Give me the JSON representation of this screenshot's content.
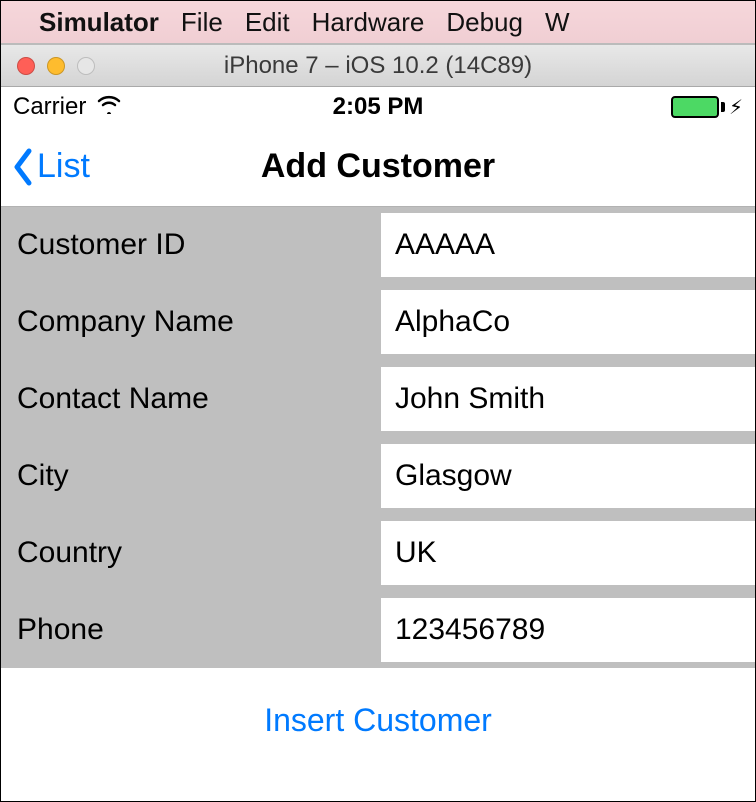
{
  "macMenu": {
    "appName": "Simulator",
    "items": [
      "File",
      "Edit",
      "Hardware",
      "Debug",
      "W"
    ]
  },
  "windowTitle": "iPhone 7 – iOS 10.2 (14C89)",
  "statusBar": {
    "carrier": "Carrier",
    "time": "2:05 PM"
  },
  "navBar": {
    "backLabel": "List",
    "title": "Add Customer"
  },
  "form": {
    "fields": [
      {
        "label": "Customer ID",
        "value": "AAAAA"
      },
      {
        "label": "Company Name",
        "value": "AlphaCo"
      },
      {
        "label": "Contact Name",
        "value": "John Smith"
      },
      {
        "label": "City",
        "value": "Glasgow"
      },
      {
        "label": "Country",
        "value": "UK"
      },
      {
        "label": "Phone",
        "value": "123456789"
      }
    ]
  },
  "actions": {
    "insertLabel": "Insert Customer"
  }
}
